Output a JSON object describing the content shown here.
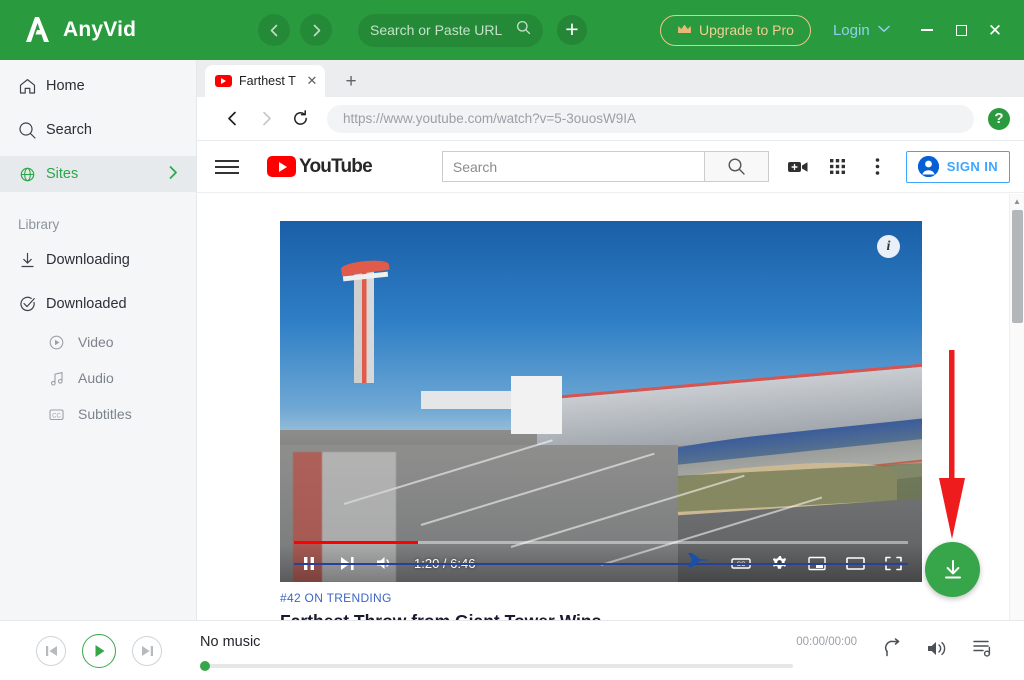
{
  "titlebar": {
    "brand": "AnyVid",
    "logo_icon": "anyvid-logo-icon",
    "back_icon": "chevron-left-icon",
    "forward_icon": "chevron-right-icon",
    "url_placeholder": "Search or Paste URL",
    "search_icon": "search-icon",
    "add_icon": "plus-icon",
    "upgrade_label": "Upgrade to Pro",
    "crown_icon": "crown-icon",
    "login_label": "Login",
    "login_chevron": "chevron-down-icon",
    "minimize_icon": "minimize-icon",
    "maximize_icon": "maximize-icon",
    "close_icon": "close-icon",
    "bg_color": "#2a9a3e",
    "accent_gold": "#f1cf93",
    "login_color": "#8fd0ef"
  },
  "sidebar": {
    "items": [
      {
        "label": "Home",
        "icon": "home-icon",
        "active": false
      },
      {
        "label": "Search",
        "icon": "search-icon",
        "active": false
      },
      {
        "label": "Sites",
        "icon": "globe-icon",
        "active": true,
        "arrow": "chevron-right-icon"
      }
    ],
    "library_heading": "Library",
    "library_items": [
      {
        "label": "Downloading",
        "icon": "download-icon"
      },
      {
        "label": "Downloaded",
        "icon": "check-circle-icon"
      }
    ],
    "sub_items": [
      {
        "label": "Video",
        "icon": "play-circle-icon"
      },
      {
        "label": "Audio",
        "icon": "music-note-icon"
      },
      {
        "label": "Subtitles",
        "icon": "closed-caption-icon"
      }
    ],
    "active_color": "#29a84a"
  },
  "browser": {
    "tab": {
      "title": "Farthest T",
      "favicon": "youtube-favicon",
      "close_icon": "close-icon"
    },
    "new_tab_icon": "plus-icon",
    "back_icon": "chevron-left-icon",
    "forward_icon": "chevron-right-icon",
    "reload_icon": "reload-icon",
    "url": "https://www.youtube.com/watch?v=5-3ouosW9IA",
    "help_label": "?",
    "help_icon": "help-icon"
  },
  "youtube": {
    "menu_icon": "hamburger-menu-icon",
    "logo_text": "YouTube",
    "logo_icon": "youtube-play-icon",
    "search_placeholder": "Search",
    "search_icon": "search-icon",
    "create_icon": "video-camera-plus-icon",
    "apps_icon": "apps-grid-icon",
    "more_icon": "three-dots-vertical-icon",
    "signin_label": "SIGN IN",
    "avatar_icon": "account-circle-icon",
    "signin_color": "#3ea6ff"
  },
  "player": {
    "info_icon": "info-icon",
    "pause_icon": "pause-icon",
    "next_icon": "next-track-icon",
    "volume_icon": "volume-icon",
    "time_current": "1:20",
    "time_total": "6:46",
    "time_display": "1:20 / 6:46",
    "captions_icon": "closed-caption-icon",
    "settings_icon": "gear-icon",
    "miniplayer_icon": "miniplayer-icon",
    "theater_icon": "theater-mode-icon",
    "fullscreen_icon": "fullscreen-icon",
    "progress_percent": 20,
    "cursor_icon": "blue-arrow-cursor-icon"
  },
  "video_meta": {
    "trending_label": "#42 ON TRENDING",
    "title": "Farthest Throw from Giant Tower Wins"
  },
  "annotations": {
    "arrow_icon": "red-down-arrow-annotation",
    "arrow_color": "#ee1c1c",
    "download_fab_icon": "download-icon",
    "download_fab_color": "#37a64a"
  },
  "scrollbar": {
    "up_icon": "scroll-up-arrow-icon",
    "down_icon": "scroll-down-arrow-icon"
  },
  "music_bar": {
    "prev_icon": "previous-track-icon",
    "play_icon": "play-icon",
    "next_icon": "next-track-icon",
    "title": "No music",
    "time": "00:00/00:00",
    "repeat_icon": "repeat-icon",
    "volume_icon": "volume-icon",
    "playlist_icon": "playlist-icon",
    "progress_percent": 0
  }
}
